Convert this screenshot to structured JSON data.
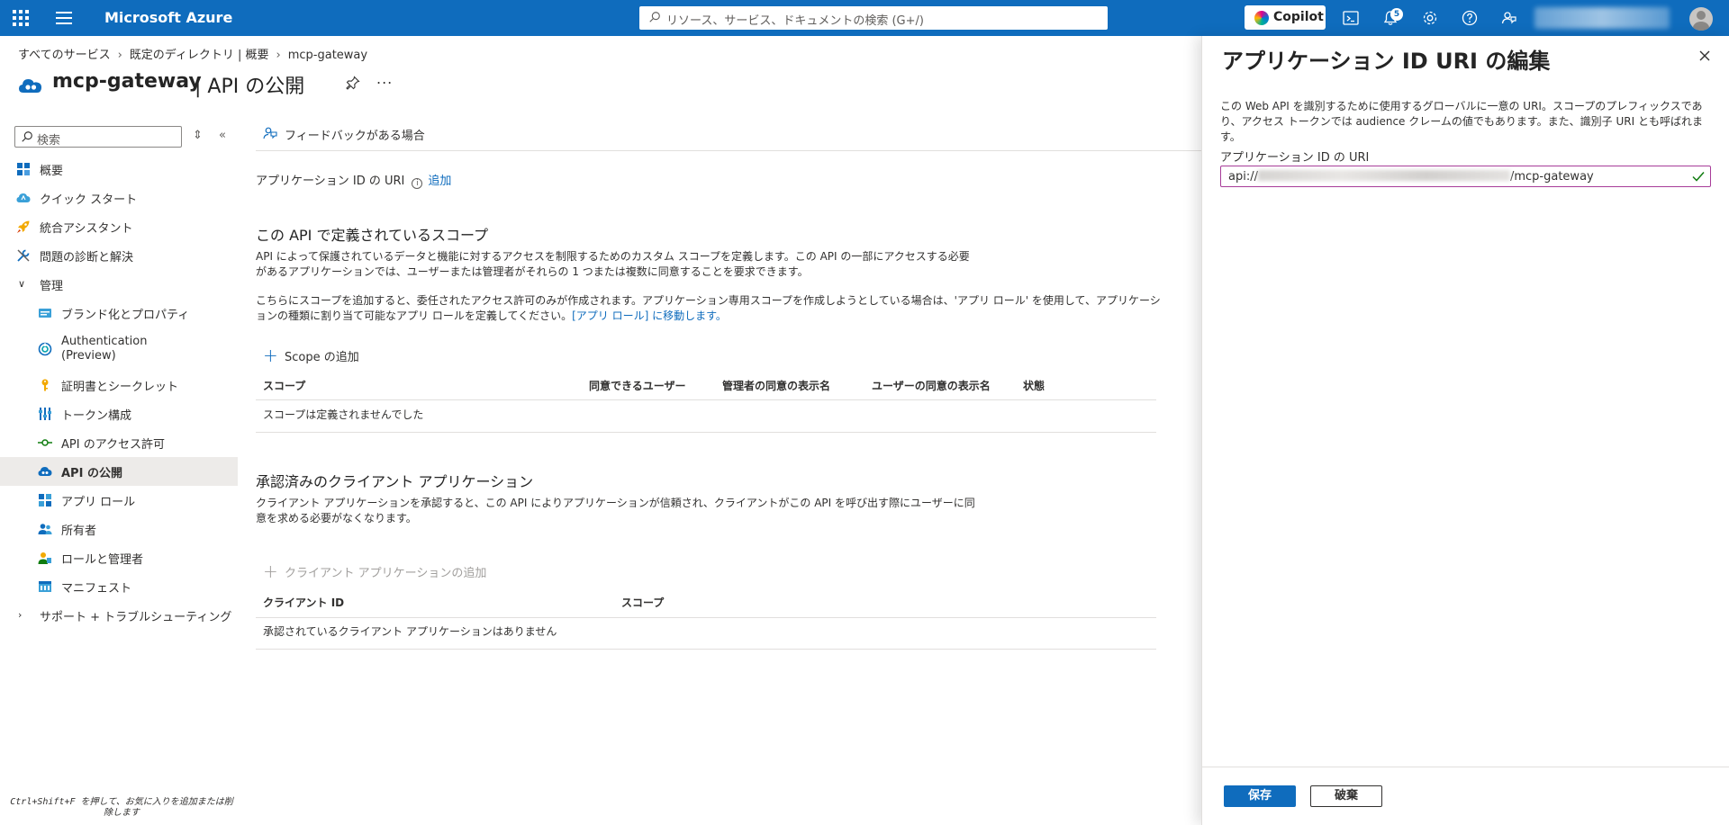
{
  "topbar": {
    "brand": "Microsoft Azure",
    "search_placeholder": "リソース、サービス、ドキュメントの検索 (G+/)",
    "copilot_label": "Copilot",
    "notifications_count": "5"
  },
  "breadcrumb": [
    "すべてのサービス",
    "既定のディレクトリ | 概要",
    "mcp-gateway"
  ],
  "page": {
    "app_name": "mcp-gateway",
    "section_title": "| API の公開",
    "more": "..."
  },
  "sidebar": {
    "search_placeholder": "検索",
    "items": [
      {
        "label": "概要",
        "level": 1,
        "icon": "overview-icon"
      },
      {
        "label": "クイック スタート",
        "level": 1,
        "icon": "quickstart-cloud-icon"
      },
      {
        "label": "統合アシスタント",
        "level": 1,
        "icon": "rocket-icon"
      },
      {
        "label": "問題の診断と解決",
        "level": 1,
        "icon": "wrench-icon"
      },
      {
        "label": "管理",
        "level": 1,
        "icon": "chevron-down-icon",
        "group": true
      },
      {
        "label": "ブランド化とプロパティ",
        "level": 2,
        "icon": "branding-icon"
      },
      {
        "label": "Authentication\n(Preview)",
        "level": 2,
        "icon": "authentication-icon"
      },
      {
        "label": "証明書とシークレット",
        "level": 2,
        "icon": "key-icon"
      },
      {
        "label": "トークン構成",
        "level": 2,
        "icon": "token-config-icon"
      },
      {
        "label": "API のアクセス許可",
        "level": 2,
        "icon": "api-permission-icon"
      },
      {
        "label": "API の公開",
        "level": 2,
        "icon": "cloud-api-icon",
        "active": true
      },
      {
        "label": "アプリ ロール",
        "level": 2,
        "icon": "app-roles-icon"
      },
      {
        "label": "所有者",
        "level": 2,
        "icon": "owners-icon"
      },
      {
        "label": "ロールと管理者",
        "level": 2,
        "icon": "roles-admins-icon"
      },
      {
        "label": "マニフェスト",
        "level": 2,
        "icon": "manifest-icon"
      },
      {
        "label": "サポート + トラブルシューティング",
        "level": 1,
        "icon": "chevron-right-icon",
        "group": true
      }
    ],
    "footer_hint": "Ctrl+Shift+F を押して、お気に入りを追加または削除します"
  },
  "main": {
    "feedback_label": "フィードバックがある場合",
    "uri_label": "アプリケーション ID の URI",
    "uri_add_link": "追加",
    "scopes": {
      "heading": "この API で定義されているスコープ",
      "desc1": "API によって保護されているデータと機能に対するアクセスを制限するためのカスタム スコープを定義します。この API の一部にアクセスする必要があるアプリケーションでは、ユーザーまたは管理者がそれらの 1 つまたは複数に同意することを要求できます。",
      "desc2_prefix": "こちらにスコープを追加すると、委任されたアクセス許可のみが作成されます。アプリケーション専用スコープを作成しようとしている場合は、'アプリ ロール' を使用して、アプリケーションの種類に割り当て可能なアプリ ロールを定義してください。",
      "desc2_link": "[アプリ ロール] に移動します。",
      "add_label": "Scope の追加",
      "columns": [
        "スコープ",
        "同意できるユーザー",
        "管理者の同意の表示名",
        "ユーザーの同意の表示名",
        "状態"
      ],
      "empty": "スコープは定義されませんでした"
    },
    "clients": {
      "heading": "承認済みのクライアント アプリケーション",
      "desc": "クライアント アプリケーションを承認すると、この API によりアプリケーションが信頼され、クライアントがこの API を呼び出す際にユーザーに同意を求める必要がなくなります。",
      "add_label": "クライアント アプリケーションの追加",
      "columns": [
        "クライアント ID",
        "スコープ"
      ],
      "empty": "承認されているクライアント アプリケーションはありません"
    }
  },
  "panel": {
    "title": "アプリケーション ID URI の編集",
    "description": "この Web API を識別するために使用するグローバルに一意の URI。スコープのプレフィックスであり、アクセス トークンでは audience クレームの値でもあります。また、識別子 URI とも呼ばれます。",
    "field_label": "アプリケーション ID の URI",
    "field_prefix": "api://",
    "field_suffix": "/mcp-gateway",
    "save_label": "保存",
    "discard_label": "破棄"
  },
  "colors": {
    "accent": "#0f6cbd",
    "field_border": "#a73c99",
    "valid_check": "#107c10"
  }
}
